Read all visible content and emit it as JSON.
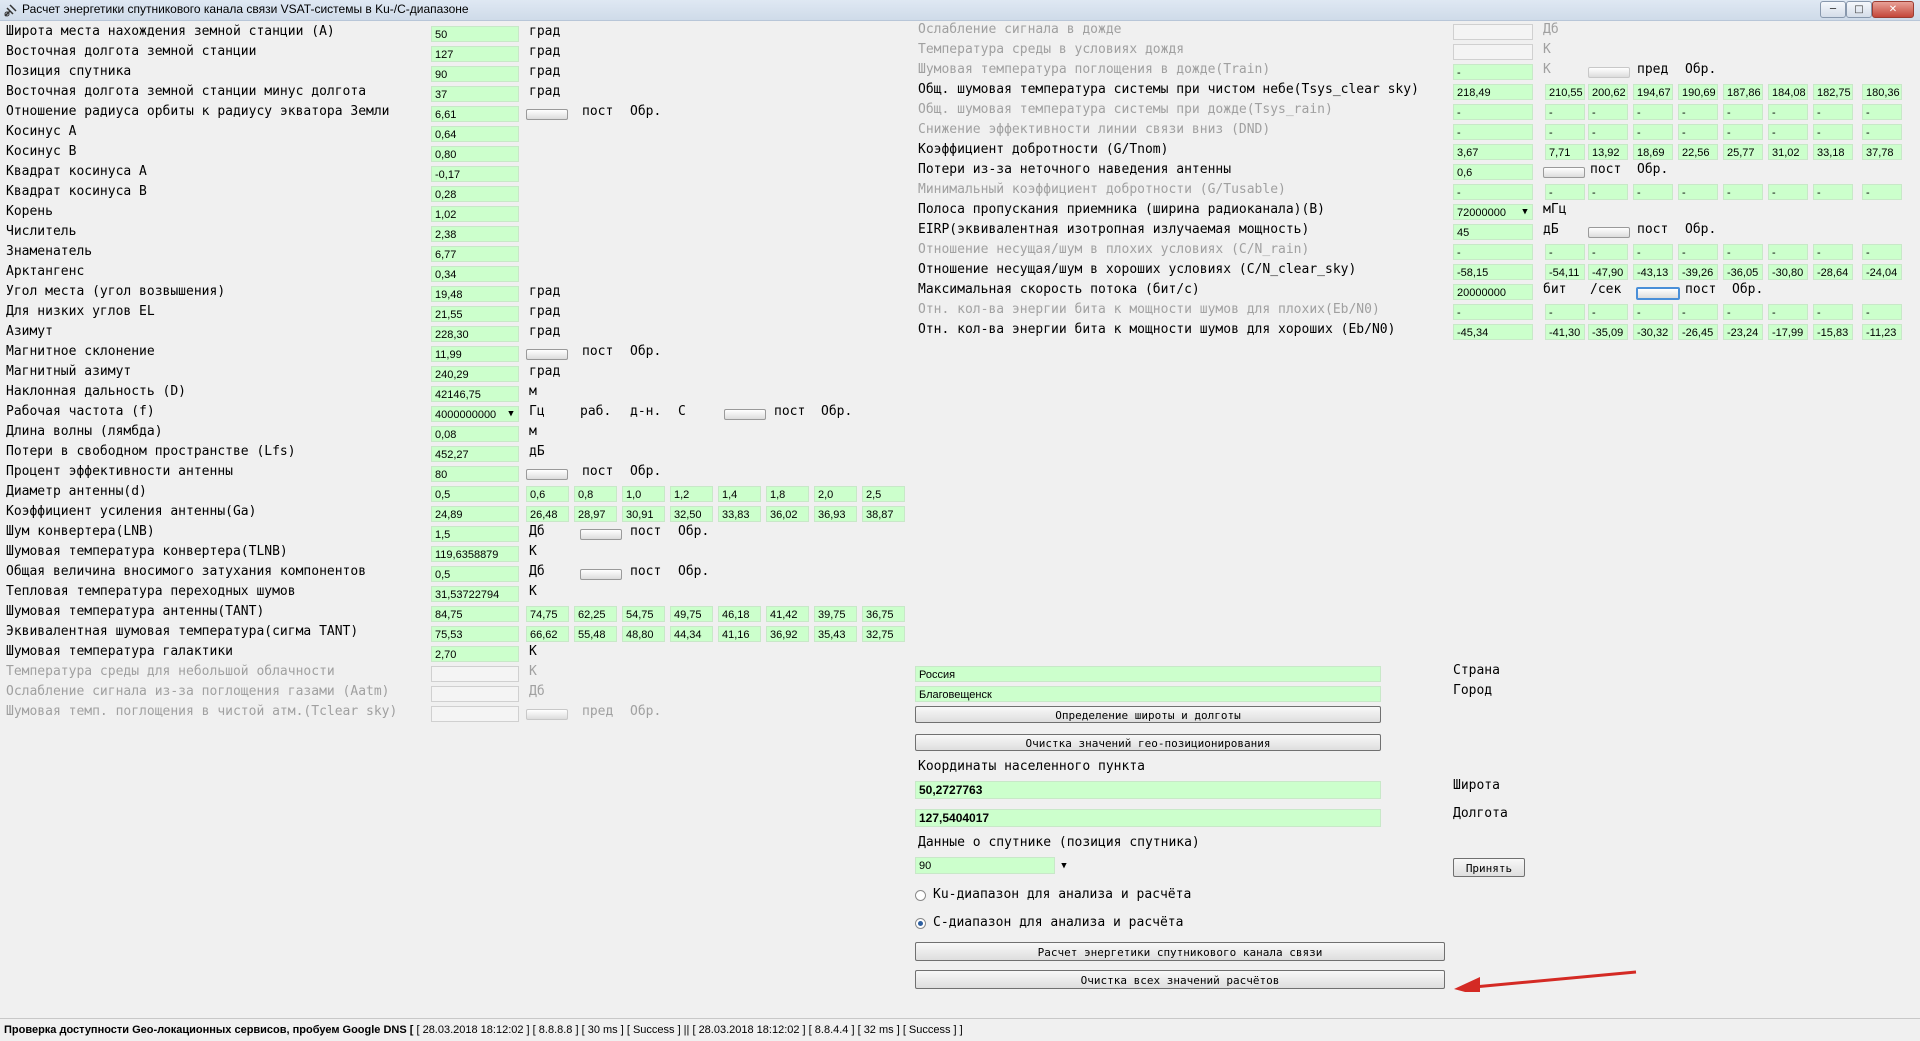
{
  "window": {
    "title": "Расчет энергетики спутникового канала связи VSAT-системы в Ku-/C-диапазоне",
    "min_label": "─",
    "max_label": "□",
    "close_label": "✕"
  },
  "left_panel": {
    "rows": [
      {
        "label": "Широта места нахождения земной станции (А)",
        "value": "50",
        "unit": "град"
      },
      {
        "label": "Восточная долгота земной станции",
        "value": "127",
        "unit": "град"
      },
      {
        "label": "Позиция спутника",
        "value": "90",
        "unit": "град"
      },
      {
        "label": "Восточная долгота земной станции минус долгота",
        "value": "37",
        "unit": "град"
      },
      {
        "label": "Отношение радиуса  орбиты к радиусу экватора Земли",
        "value": "6,61",
        "unit": "",
        "opt1": "пост",
        "opt2": "Обр."
      },
      {
        "label": "Косинус А",
        "value": "0,64",
        "unit": ""
      },
      {
        "label": "Косинус B",
        "value": "0,80",
        "unit": ""
      },
      {
        "label": "Квадрат косинуса А",
        "value": "-0,17",
        "unit": ""
      },
      {
        "label": "Квадрат косинуса B",
        "value": "0,28",
        "unit": ""
      },
      {
        "label": "Корень",
        "value": "1,02",
        "unit": ""
      },
      {
        "label": "Числитель",
        "value": "2,38",
        "unit": ""
      },
      {
        "label": "Знаменатель",
        "value": "6,77",
        "unit": ""
      },
      {
        "label": "Арктангенс",
        "value": "0,34",
        "unit": ""
      },
      {
        "label": "Угол места (угол возвышения)",
        "value": "19,48",
        "unit": "град"
      },
      {
        "label": "Для низких углов EL",
        "value": "21,55",
        "unit": "град"
      },
      {
        "label": "Азимут",
        "value": "228,30",
        "unit": "град"
      },
      {
        "label": "Магнитное склонение",
        "value": "11,99",
        "unit": "",
        "opt1": "пост",
        "opt2": "Обр."
      },
      {
        "label": "Магнитный азимут",
        "value": "240,29",
        "unit": "град"
      },
      {
        "label": "Наклонная дальность (D)",
        "value": "42146,75",
        "unit": "м"
      },
      {
        "label": "Рабочая частота (f)",
        "value": "4000000000",
        "unit": "Гц",
        "extra": [
          "раб.",
          "д-н.",
          "С"
        ],
        "opt1": "пост",
        "opt2": "Обр."
      },
      {
        "label": "Длина волны (лямбда)",
        "value": "0,08",
        "unit": "м"
      },
      {
        "label": "Потери в свободном пространстве (Lfs)",
        "value": "452,27",
        "unit": "дБ"
      },
      {
        "label": "Процент эффективности антенны",
        "value": "80",
        "unit": "",
        "opt1": "пост",
        "opt2": "Обр."
      },
      {
        "label": "Диаметр антенны(d)",
        "value": "0,5",
        "unit": "",
        "series": [
          "0,6",
          "0,8",
          "1,0",
          "1,2",
          "1,4",
          "1,8",
          "2,0",
          "2,5"
        ]
      },
      {
        "label": "Коэффициент усиления антенны(Ga)",
        "value": "24,89",
        "unit": "",
        "series": [
          "26,48",
          "28,97",
          "30,91",
          "32,50",
          "33,83",
          "36,02",
          "36,93",
          "38,87"
        ]
      },
      {
        "label": "Шум конвертера(LNB)",
        "value": "1,5",
        "unit": "Дб",
        "opt1": "пост",
        "opt2": "Обр."
      },
      {
        "label": "Шумовая температура конвертера(TLNB)",
        "value": "119,6358879",
        "unit": "К"
      },
      {
        "label": "Общая величина вносимого затухания компонентов",
        "value": "0,5",
        "unit": "Дб",
        "opt1": "пост",
        "opt2": "Обр."
      },
      {
        "label": "Тепловая температура переходных шумов",
        "value": "31,53722794",
        "unit": "К"
      },
      {
        "label": "Шумовая температура антенны(TANT)",
        "value": "84,75",
        "unit": "",
        "series": [
          "74,75",
          "62,25",
          "54,75",
          "49,75",
          "46,18",
          "41,42",
          "39,75",
          "36,75"
        ]
      },
      {
        "label": "Эквивалентная шумовая температура(сигма TANT)",
        "value": "75,53",
        "unit": "",
        "series": [
          "66,62",
          "55,48",
          "48,80",
          "44,34",
          "41,16",
          "36,92",
          "35,43",
          "32,75"
        ]
      },
      {
        "label": "Шумовая температура галактики",
        "value": "2,70",
        "unit": "К"
      },
      {
        "label": "Температура среды для небольшой облачности",
        "value": "",
        "unit": "К",
        "disabled": true
      },
      {
        "label": "Ослабление сигнала из-за поглощения газами (Aatm)",
        "value": "",
        "unit": "Дб",
        "disabled": true
      },
      {
        "label": "Шумовая темп. поглощения в чистой атм.(Tclear sky)",
        "value": "",
        "unit": "",
        "disabled": true,
        "opt1": "пред",
        "opt2": "Обр."
      }
    ]
  },
  "right_panel": {
    "rows": [
      {
        "label": "Ослабление сигнала в дожде",
        "disabled": true,
        "value": "",
        "unit": "Дб"
      },
      {
        "label": "Температура среды в условиях дождя",
        "disabled": true,
        "value": "",
        "unit": "К"
      },
      {
        "label": "Шумовая температура поглощения в дожде(Train)",
        "disabled": true,
        "value": "-",
        "unit": "К",
        "opt1": "пред",
        "opt2": "Обр."
      },
      {
        "label": "Общ. шумовая температура системы при чистом небе(Tsys_clear sky)",
        "value": "218,49",
        "series": [
          "210,55",
          "200,62",
          "194,67",
          "190,69",
          "187,86",
          "184,08",
          "182,75",
          "180,36"
        ]
      },
      {
        "label": "Общ. шумовая температура системы при дожде(Tsys_rain)",
        "disabled": true,
        "value": "-",
        "series": [
          "-",
          "-",
          "-",
          "-",
          "-",
          "-",
          "-",
          "-"
        ]
      },
      {
        "label": "Снижение эффективности линии связи вниз (DND)",
        "disabled": true,
        "value": "-",
        "series": [
          "-",
          "-",
          "-",
          "-",
          "-",
          "-",
          "-",
          "-"
        ]
      },
      {
        "label": "Коэффициент добротности (G/Tnom)",
        "value": "3,67",
        "series": [
          "7,71",
          "13,92",
          "18,69",
          "22,56",
          "25,77",
          "31,02",
          "33,18",
          "37,78"
        ]
      },
      {
        "label": "Потери из-за неточного наведения антенны",
        "value": "0,6",
        "unit": "",
        "opt1": "пост",
        "opt2": "Обр."
      },
      {
        "label": "Минимальный коэффициент добротности (G/Tusable)",
        "disabled": true,
        "value": "-",
        "series": [
          "-",
          "-",
          "-",
          "-",
          "-",
          "-",
          "-",
          "-"
        ]
      },
      {
        "label": "Полоса пропускания приемника (ширина радиоканала)(B)",
        "value": "72000000",
        "unit": "мГц",
        "dropdown": true
      },
      {
        "label": "EIRP(эквивалентная изотропная излучаемая мощность)",
        "value": "45",
        "unit": "дБ",
        "opt1": "пост",
        "opt2": "Обр."
      },
      {
        "label": "Отношение несущая/шум в плохих условиях (C/N_rain)",
        "disabled": true,
        "value": "-",
        "series": [
          "-",
          "-",
          "-",
          "-",
          "-",
          "-",
          "-",
          "-"
        ]
      },
      {
        "label": "Отношение несущая/шум в хороших условиях (C/N_clear_sky)",
        "value": "-58,15",
        "series": [
          "-54,11",
          "-47,90",
          "-43,13",
          "-39,26",
          "-36,05",
          "-30,80",
          "-28,64",
          "-24,04"
        ]
      },
      {
        "label": "Максимальная скорость потока (бит/с)",
        "value": "20000000",
        "unit": "бит",
        "unit2": "/сек",
        "opt1": "пост",
        "opt2": "Обр."
      },
      {
        "label": "Отн. кол-ва энергии бита к мощности шумов для плохих(Eb/N0)",
        "disabled": true,
        "value": "-",
        "series": [
          "-",
          "-",
          "-",
          "-",
          "-",
          "-",
          "-",
          "-"
        ]
      },
      {
        "label": "Отн. кол-ва энергии бита к мощности шумов для хороших (Eb/N0)",
        "value": "-45,34",
        "series": [
          "-41,30",
          "-35,09",
          "-30,32",
          "-26,45",
          "-23,24",
          "-17,99",
          "-15,83",
          "-11,23"
        ]
      }
    ]
  },
  "geo": {
    "country_value": "Россия",
    "country_label": "Страна",
    "city_value": "Благовещенск",
    "city_label": "Город",
    "determine_button": "Определение широты и долготы",
    "clear_geo_button": "Очистка значений гео-позиционирования",
    "coords_title": "Координаты населенного пункта",
    "lat_value": "50,2727763",
    "lat_label": "Широта",
    "lon_value": "127,5404017",
    "lon_label": "Долгота",
    "sat_title": "Данные о спутнике (позиция спутника)",
    "sat_value": "90",
    "accept_button": "Принять",
    "ku_label": "Ku-диапазон для анализа и расчёта",
    "c_label": "С-диапазон для анализа и расчёта",
    "calc_button": "Расчет энергетики спутникового канала связи",
    "clear_all_button": "Очистка всех значений расчётов"
  },
  "status": {
    "lead": "Проверка доступности Geo-локационных сервисов, пробуем Google DNS [",
    "rest": " [ 28.03.2018 18:12:02 ] [ 8.8.8.8 ] [ 30 ms ] [ Success ]  ||  [ 28.03.2018 18:12:02 ] [ 8.8.4.4 ] [ 32 ms ] [ Success ] ]"
  },
  "colors": {
    "field_green": "#ccffcc",
    "annotation_arrow": "#d42a24"
  }
}
